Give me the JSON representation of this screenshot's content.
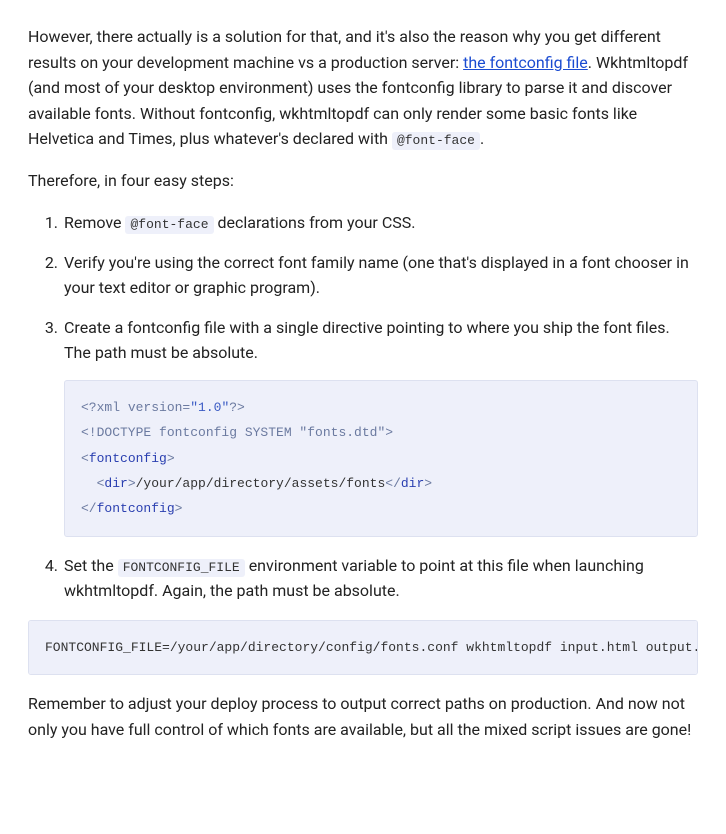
{
  "p1": {
    "frag0": "However, there actually is a solution for that, and it's also the reason why you get different results on your development machine vs a production server: ",
    "link_text": "the fontconfig file",
    "frag1": ". Wkhtmltopdf (and most of your desktop environment) uses the fontconfig library to parse it and discover available fonts. Without fontconfig, wkhtmltopdf can only render some basic fonts like Helvetica and Times, plus whatever's declared with ",
    "code": "@font-face",
    "frag2": "."
  },
  "p2": "Therefore, in four easy steps:",
  "steps": {
    "s1": {
      "frag0": "Remove ",
      "code": "@font-face",
      "frag1": " declarations from your CSS."
    },
    "s2": "Verify you're using the correct font family name (one that's displayed in a font chooser in your text editor or graphic program).",
    "s3": {
      "text": "Create a fontconfig file with a single directive pointing to where you ship the font files. The path must be absolute.",
      "code": {
        "l1_a": "<?xml",
        "l1_b": " version=",
        "l1_c": "\"1.0\"",
        "l1_d": "?>",
        "l2_a": "<!DOCTYPE fontconfig SYSTEM \"fonts.dtd\">",
        "l3_a": "<",
        "l3_b": "fontconfig",
        "l3_c": ">",
        "l4_a": "  <",
        "l4_b": "dir",
        "l4_c": ">",
        "l4_d": "/your/app/directory/assets/fonts",
        "l4_e": "</",
        "l4_f": "dir",
        "l4_g": ">",
        "l5_a": "</",
        "l5_b": "fontconfig",
        "l5_c": ">"
      }
    },
    "s4": {
      "frag0": "Set the ",
      "code": "FONTCONFIG_FILE",
      "frag1": " environment variable to point at this file when launching wkhtmltopdf. Again, the path must be absolute."
    }
  },
  "cmd": "FONTCONFIG_FILE=/your/app/directory/config/fonts.conf wkhtmltopdf input.html output.pdf",
  "p3": "Remember to adjust your deploy process to output correct paths on production. And now not only you have full control of which fonts are available, but all the mixed script issues are gone!"
}
